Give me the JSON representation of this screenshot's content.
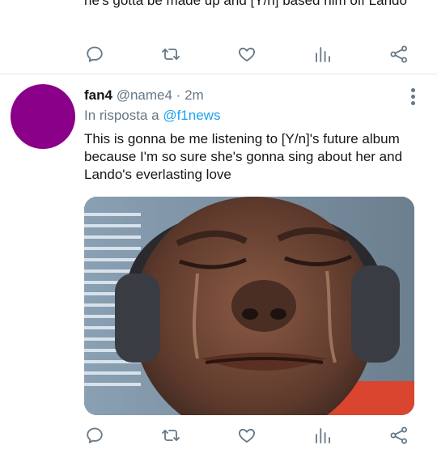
{
  "previous_tweet": {
    "text": "he's gotta be made up and [Y/n] based him off Lando"
  },
  "tweet": {
    "display_name": "fan4",
    "handle": "@name4",
    "separator": " · ",
    "time": "2m",
    "reply_prefix": "In risposta a ",
    "reply_to": "@f1news",
    "text": "This is gonna be me listening to [Y/n]'s future album because I'm so sure she's gonna sing about her and Lando's everlasting love",
    "avatar_color": "#8b0089"
  },
  "icons": {
    "reply": "comment-icon",
    "retweet": "retweet-icon",
    "like": "heart-icon",
    "stats": "analytics-icon",
    "share": "share-icon",
    "more": "more-vertical-icon"
  },
  "colors": {
    "text": "#14171a",
    "secondary": "#657786",
    "link": "#1da1f2",
    "divider": "#e1e8ed"
  },
  "media": {
    "alt": "crying person wearing headphones"
  }
}
